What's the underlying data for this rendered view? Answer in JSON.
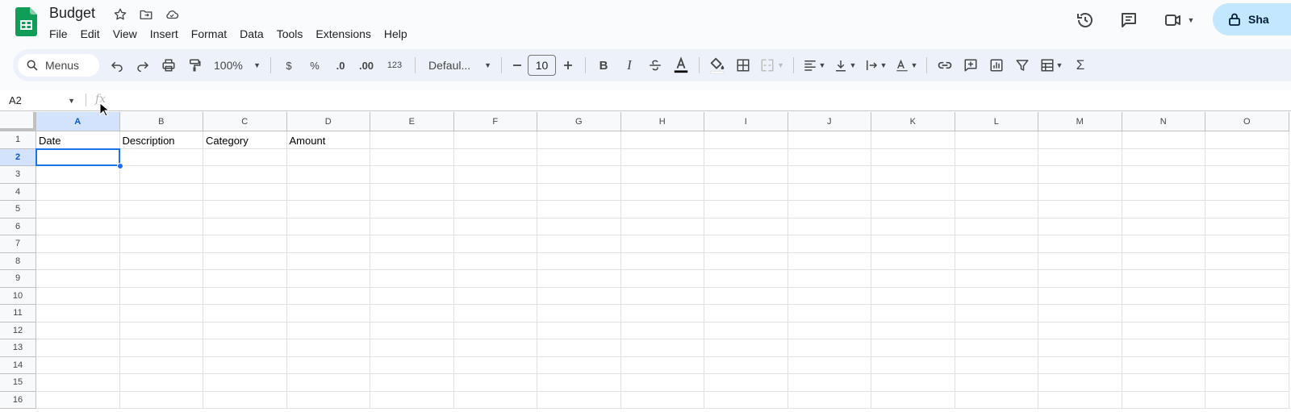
{
  "doc": {
    "title": "Budget"
  },
  "menu": [
    "File",
    "Edit",
    "View",
    "Insert",
    "Format",
    "Data",
    "Tools",
    "Extensions",
    "Help"
  ],
  "header": {
    "share_label": "Sha"
  },
  "toolbar": {
    "menus_label": "Menus",
    "zoom": "100%",
    "currency": "$",
    "percent": "%",
    "decrease_decimals": ".0",
    "increase_decimals": ".00",
    "number_format": "123",
    "font": "Defaul...",
    "font_size": "10",
    "icons": [
      "undo-icon",
      "redo-icon",
      "print-icon",
      "paint-format-icon",
      "bold-icon",
      "italic-icon",
      "strikethrough-icon",
      "text-color-icon",
      "fill-color-icon",
      "borders-icon",
      "merge-cells-icon",
      "align-left-icon",
      "vertical-align-icon",
      "text-wrap-icon",
      "text-rotate-icon",
      "link-icon",
      "comment-icon",
      "chart-icon",
      "filter-icon",
      "filter-views-icon",
      "functions-icon"
    ]
  },
  "formula_bar": {
    "cell_ref": "A2",
    "fx_label": "fx",
    "value": ""
  },
  "grid": {
    "columns": [
      "A",
      "B",
      "C",
      "D",
      "E",
      "F",
      "G",
      "H",
      "I",
      "J",
      "K",
      "L",
      "M",
      "N",
      "O"
    ],
    "rows": [
      "1",
      "2",
      "3",
      "4",
      "5",
      "6",
      "7",
      "8",
      "9",
      "10",
      "11",
      "12",
      "13",
      "14",
      "15",
      "16"
    ],
    "selected_column": "A",
    "selected_row": "2",
    "cells": {
      "A1": "Date",
      "B1": "Description",
      "C1": "Category",
      "D1": "Amount"
    }
  },
  "colors": {
    "accent": "#1a73e8",
    "selection_header": "#d3e3fd",
    "share_button": "#c2e7ff",
    "sheets_green": "#0f9d58"
  }
}
